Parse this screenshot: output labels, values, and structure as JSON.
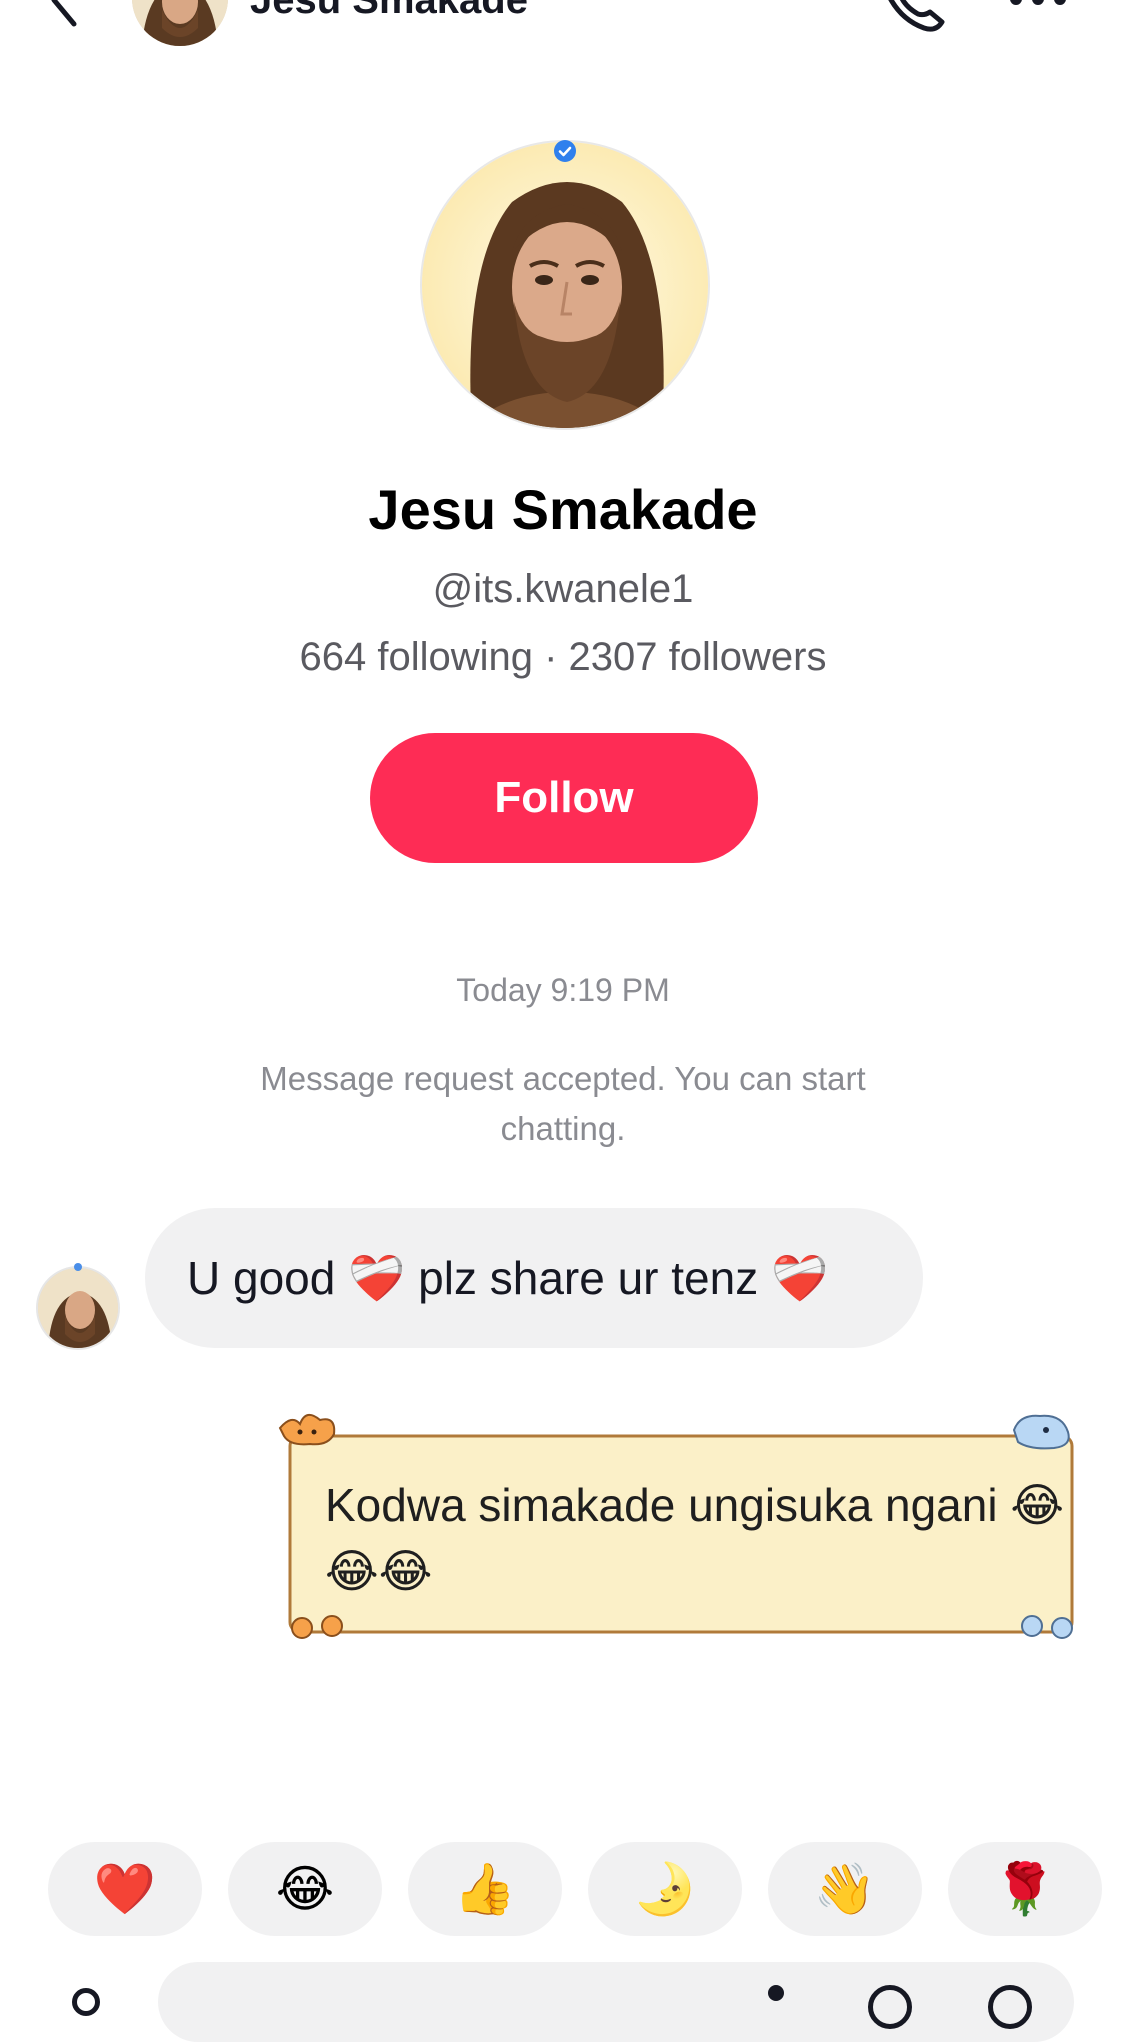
{
  "header": {
    "name": "Jesu Smakade",
    "back_icon": "back-arrow-icon",
    "call_icon": "phone-icon",
    "more_icon": "more-icon"
  },
  "profile": {
    "name": "Jesu Smakade",
    "handle": "@its.kwanele1",
    "stats": "664 following · 2307 followers",
    "verified": true,
    "follow_label": "Follow"
  },
  "chat": {
    "timestamp": "Today 9:19 PM",
    "system_message": "Message request accepted. You can start chatting.",
    "messages": [
      {
        "direction": "incoming",
        "text": "U good ❤️‍🩹 plz share ur tenz ❤️‍🩹"
      },
      {
        "direction": "outgoing",
        "text": "Kodwa simakade ungisuka ngani 😂😂😂"
      }
    ]
  },
  "quick_reactions": [
    "❤️",
    "😂",
    "👍",
    "🌛",
    "👋",
    "🌹"
  ],
  "colors": {
    "accent": "#fe2c55",
    "bubble_incoming": "#f1f1f2",
    "sticker_bubble": "#fbf0c8",
    "verified": "#2f80ed"
  }
}
